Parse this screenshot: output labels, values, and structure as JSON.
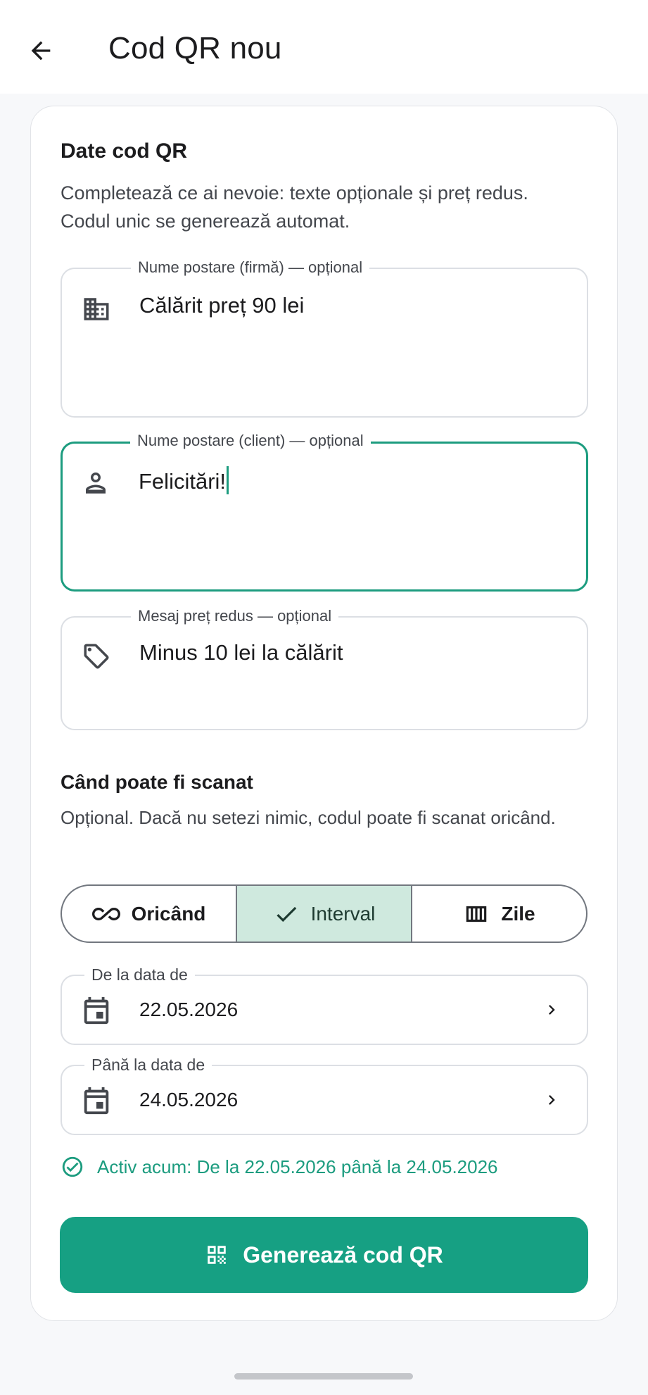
{
  "appbar": {
    "title": "Cod QR nou"
  },
  "section1": {
    "heading": "Date cod QR",
    "description": "Completează ce ai nevoie: texte opționale și preț redus. Codul unic se generează automat."
  },
  "fields": {
    "company": {
      "label": "Nume postare (firmă) — opțional",
      "value": "Călărit preț 90 lei",
      "icon": "building-icon"
    },
    "client": {
      "label": "Nume postare (client) — opțional",
      "value": "Felicitări!",
      "icon": "person-icon"
    },
    "discount": {
      "label": "Mesaj preț redus — opțional",
      "value": "Minus 10 lei la călărit",
      "icon": "tag-icon"
    }
  },
  "section2": {
    "heading": "Când poate fi scanat",
    "description": "Opțional. Dacă nu setezi nimic, codul poate fi scanat oricând."
  },
  "segments": [
    {
      "label": "Oricând",
      "icon": "infinity-icon",
      "selected": false
    },
    {
      "label": "Interval",
      "icon": "check-icon",
      "selected": true
    },
    {
      "label": "Zile",
      "icon": "view-week-icon",
      "selected": false
    }
  ],
  "dates": {
    "from": {
      "label": "De la data de",
      "value": "22.05.2026"
    },
    "to": {
      "label": "Până la data de",
      "value": "24.05.2026"
    }
  },
  "status": {
    "text": "Activ acum: De la 22.05.2026 până la 24.05.2026"
  },
  "primary_button": {
    "label": "Generează cod QR",
    "icon": "qr-code-icon"
  },
  "colors": {
    "accent": "#16a083",
    "selected_segment": "#cfe9de",
    "status": "#1c9c7f"
  }
}
